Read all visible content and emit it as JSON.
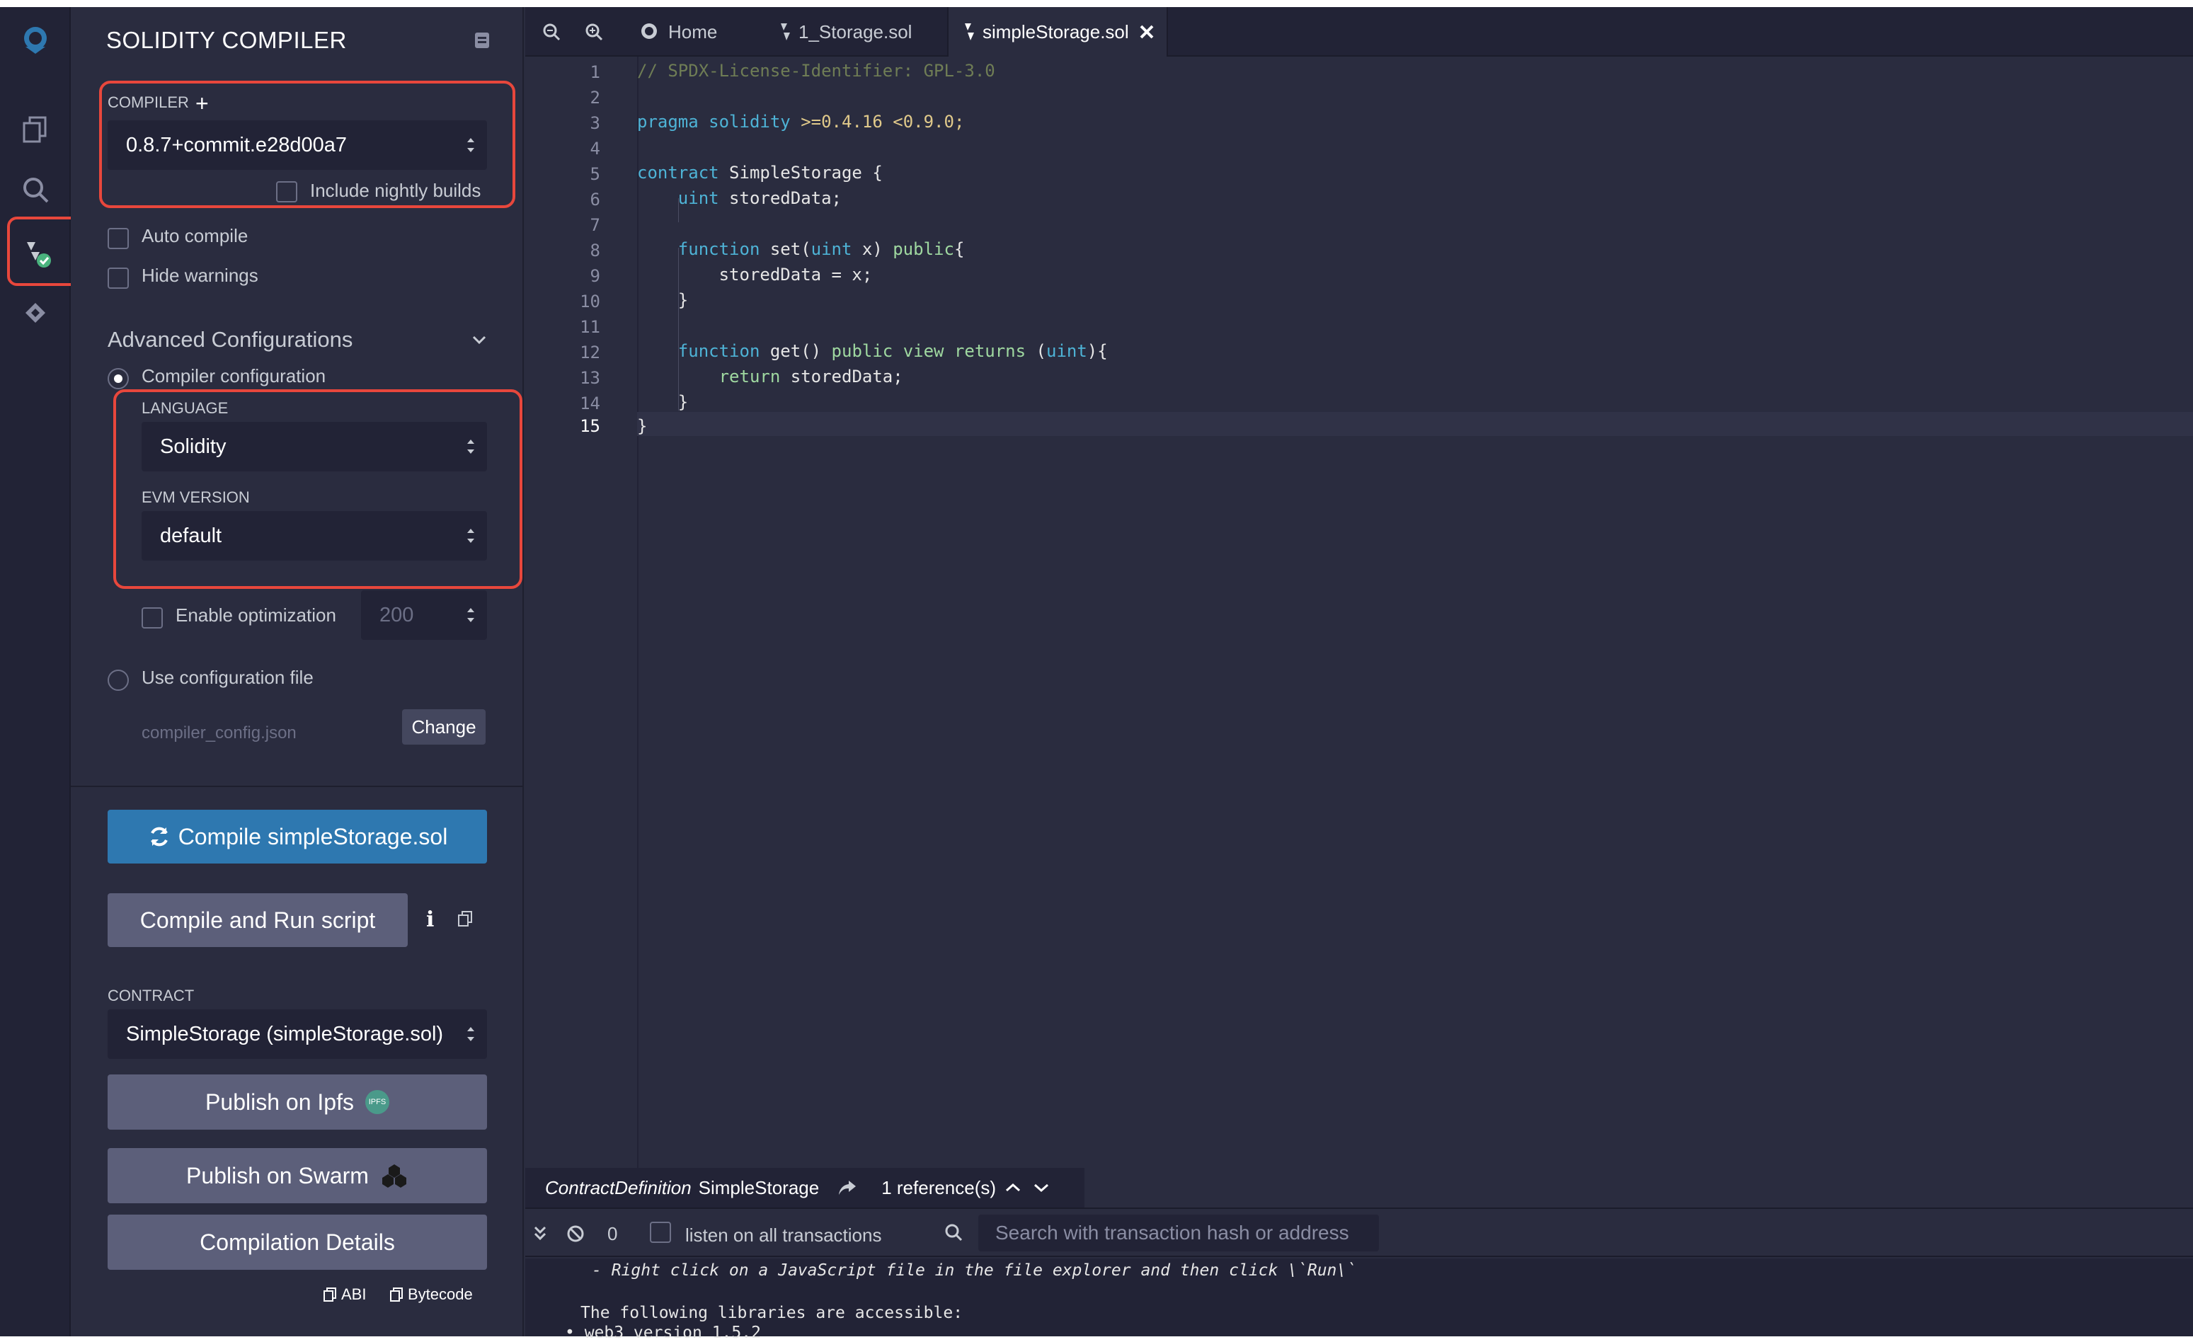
{
  "panel": {
    "title": "SOLIDITY COMPILER",
    "compiler_label": "COMPILER",
    "compiler_version": "0.8.7+commit.e28d00a7",
    "nightly_label": "Include nightly builds",
    "auto_compile": "Auto compile",
    "hide_warnings": "Hide warnings",
    "advanced_title": "Advanced Configurations",
    "compiler_config": "Compiler configuration",
    "language_label": "LANGUAGE",
    "language_value": "Solidity",
    "evm_label": "EVM VERSION",
    "evm_value": "default",
    "enable_opt": "Enable optimization",
    "opt_runs": "200",
    "use_config_file": "Use configuration file",
    "config_file": "compiler_config.json",
    "change_btn": "Change",
    "compile_btn": "Compile simpleStorage.sol",
    "compile_run_btn": "Compile and Run script",
    "contract_label": "CONTRACT",
    "contract_value": "SimpleStorage (simpleStorage.sol)",
    "publish_ipfs": "Publish on Ipfs",
    "ipfs_badge": "IPFS",
    "publish_swarm": "Publish on Swarm",
    "compilation_details": "Compilation Details",
    "abi": "ABI",
    "bytecode": "Bytecode"
  },
  "tabs": {
    "home": "Home",
    "storage": "1_Storage.sol",
    "simple": "simpleStorage.sol"
  },
  "code": {
    "line_numbers": [
      "1",
      "2",
      "3",
      "4",
      "5",
      "6",
      "7",
      "8",
      "9",
      "10",
      "11",
      "12",
      "13",
      "14",
      "15"
    ],
    "l1": "// SPDX-License-Identifier: GPL-3.0",
    "l3_kw": "pragma solidity",
    "l3_rest": " >=0.4.16 <0.9.0;",
    "l5_kw": "contract",
    "l5_rest": " SimpleStorage {",
    "l6_kw": "    uint",
    "l6_rest": " storedData;",
    "l8_kw": "    function",
    "l8_a": " set(",
    "l8_kw2": "uint",
    "l8_b": " x) ",
    "l8_kw3": "public",
    "l8_c": "{",
    "l9": "        storedData = x;",
    "l10": "    }",
    "l12_kw": "    function",
    "l12_a": " get() ",
    "l12_kw2": "public view returns",
    "l12_b": " (",
    "l12_kw3": "uint",
    "l12_c": "){",
    "l13_kw": "        return",
    "l13_rest": " storedData;",
    "l14": "    }",
    "l15": "}"
  },
  "refbar": {
    "kind": "ContractDefinition",
    "name": "SimpleStorage",
    "refs": "1 reference(s)"
  },
  "terminal": {
    "count": "0",
    "listen": "listen on all transactions",
    "search_placeholder": "Search with transaction hash or address",
    "line1": "- Right click on a JavaScript file in the file explorer and then click \\`Run\\`",
    "line2": "The following libraries are accessible:",
    "line3": "• web3 version 1.5.2"
  },
  "colors": {
    "accent": "#2e78b0",
    "highlight": "#e8473c",
    "success": "#4ab37e"
  }
}
